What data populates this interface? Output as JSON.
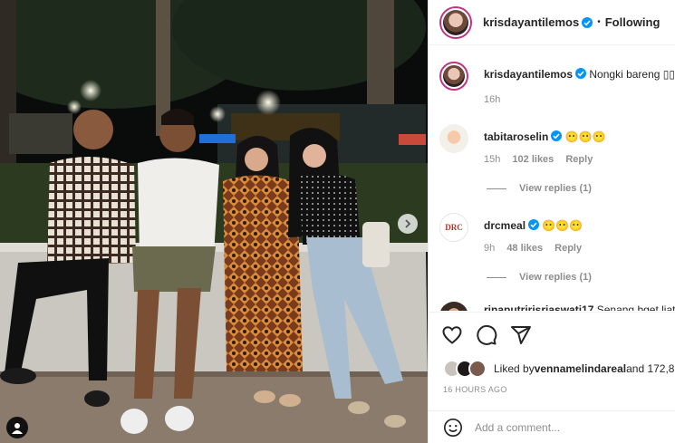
{
  "post": {
    "author": "krisdayantilemos",
    "follow_label": "Following",
    "separator": "•",
    "caption": "Nongki bareng",
    "caption_trailing": "▯▯",
    "caption_time": "16h"
  },
  "comments": [
    {
      "username": "tabitaroselin",
      "text": "😶😶😶",
      "time": "15h",
      "likes": "102 likes",
      "reply": "Reply",
      "view_replies": "View replies (1)"
    },
    {
      "username": "drcmeal",
      "text": "😶😶😶",
      "time": "9h",
      "likes": "48 likes",
      "reply": "Reply",
      "view_replies": "View replies (1)"
    },
    {
      "username": "rinaputririsriaswati17",
      "text": "Senang bget liat"
    }
  ],
  "actions": {
    "liked_prefix": "Liked by ",
    "liked_user": "vennamelindareal",
    "liked_suffix": " and 172,8",
    "timestamp": "16 HOURS AGO",
    "comment_placeholder": "Add a comment..."
  },
  "icons": {
    "like": "heart-icon",
    "comment": "comment-icon",
    "share": "share-icon",
    "emoji": "emoji-icon",
    "next": "chevron-right-icon",
    "tags": "user-tag-icon",
    "verified": "verified-badge-icon"
  },
  "colors": {
    "verified": "#0095f6",
    "muted": "#8e8e8e",
    "text": "#262626",
    "story_ring": "#c13584"
  }
}
